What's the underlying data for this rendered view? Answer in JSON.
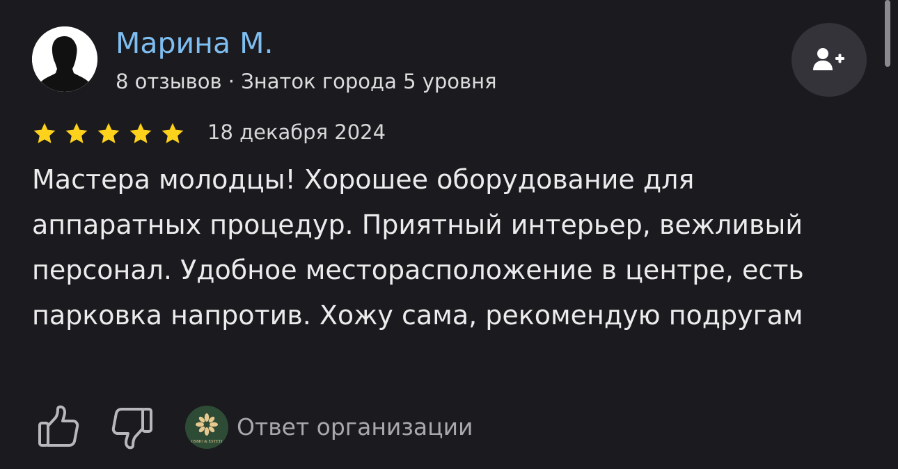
{
  "author": {
    "name": "Марина М.",
    "meta": "8 отзывов · Знаток города 5 уровня"
  },
  "review": {
    "rating": 5,
    "rating_max": 5,
    "date": "18 декабря 2024",
    "text": "Мастера молодцы! Хорошее оборудование для аппаратных процедур. Приятный интерьер, вежливый персонал. Удобное месторасположение в центре, есть парковка напротив. Хожу сама, рекомендую подругам"
  },
  "actions": {
    "like_icon": "thumbs-up-icon",
    "dislike_icon": "thumbs-down-icon",
    "org_reply_label": "Ответ организации",
    "org_logo_text": "OSMO & ESTETI"
  },
  "icons": {
    "subscribe": "add-user-icon"
  },
  "colors": {
    "background": "#1b1a1f",
    "author_name": "#7fbef0",
    "star": "#fcd21c",
    "button_bg": "#343339",
    "org_logo_bg": "#2d4b35",
    "muted_text": "#a9a9ad"
  }
}
